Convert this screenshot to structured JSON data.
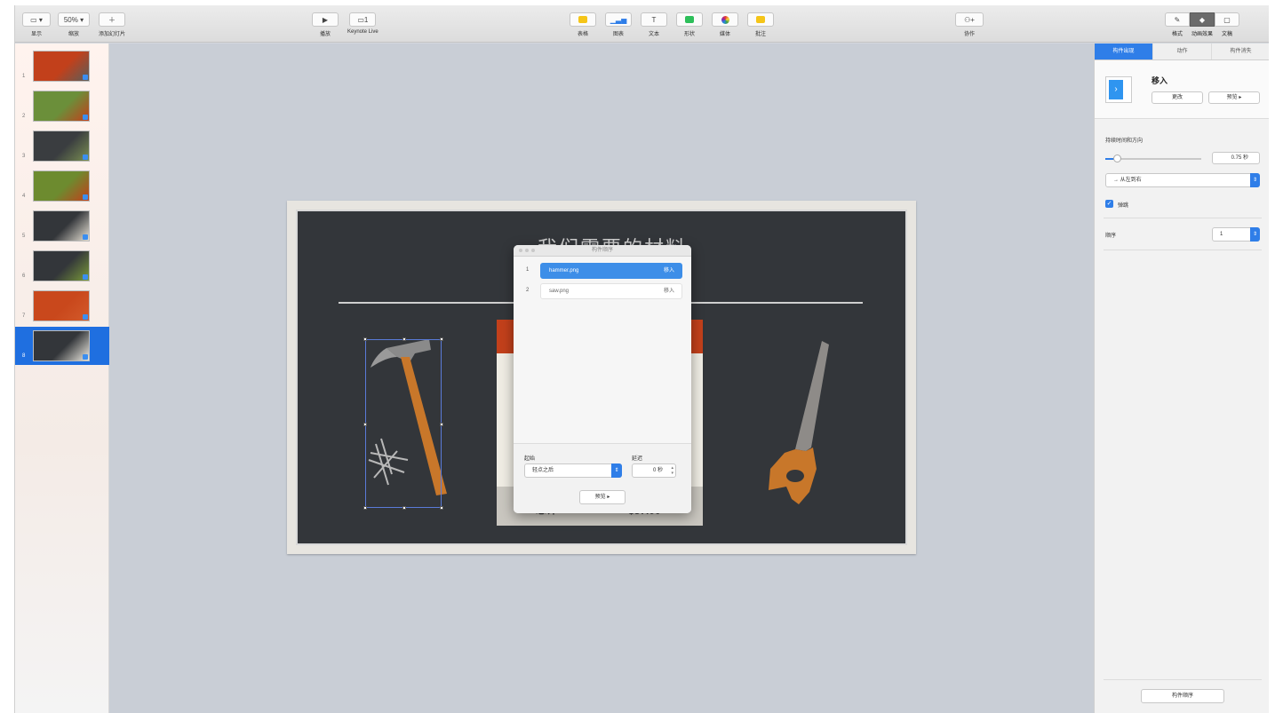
{
  "toolbar": {
    "view_label": "显示",
    "zoom_value": "50%",
    "zoom_label": "缩放",
    "add_slide_label": "添加幻灯片",
    "play_label": "播放",
    "keynote_live_label": "Keynote Live",
    "table_label": "表格",
    "chart_label": "图表",
    "text_label": "文本",
    "shape_label": "形状",
    "media_label": "媒体",
    "comment_label": "批注",
    "collaborate_label": "协作",
    "format_label": "格式",
    "animate_label": "动画效果",
    "document_label": "文稿"
  },
  "navigator": {
    "slides": [
      {
        "number": "1",
        "colors": [
          "#c2401b",
          "#5b5e5a"
        ]
      },
      {
        "number": "2",
        "colors": [
          "#6b8f3a",
          "#c2401b"
        ]
      },
      {
        "number": "3",
        "colors": [
          "#3a3d40",
          "#7a8f52"
        ]
      },
      {
        "number": "4",
        "colors": [
          "#6d8b2f",
          "#c2401b"
        ]
      },
      {
        "number": "5",
        "colors": [
          "#33363a",
          "#e8e2d6"
        ]
      },
      {
        "number": "6",
        "colors": [
          "#33363a",
          "#7a9a3a"
        ]
      },
      {
        "number": "7",
        "colors": [
          "#c9481c",
          "#d35a2a"
        ]
      },
      {
        "number": "8",
        "colors": [
          "#33363a",
          "#efece3"
        ]
      }
    ],
    "selected_index": 7
  },
  "slide": {
    "title": "我们需要的材料",
    "total_label": "总计",
    "total_value": "$37.00"
  },
  "build_popup": {
    "title": "构件顺序",
    "builds": [
      {
        "number": "1",
        "file": "hammer.png",
        "effect": "移入",
        "selected": true
      },
      {
        "number": "2",
        "file": "saw.png",
        "effect": "移入",
        "selected": false
      }
    ],
    "start_label": "起始",
    "start_value": "轻点之后",
    "delay_label": "延迟",
    "delay_value": "0 秒",
    "preview_button": "预览 ▸"
  },
  "inspector": {
    "tabs": [
      "构件出现",
      "动作",
      "构件消失"
    ],
    "active_tab": 0,
    "effect_name": "移入",
    "change_button": "更改",
    "preview_button": "预览 ▸",
    "duration_label": "持续时间和方向",
    "duration_value": "0.75 秒",
    "duration_fraction": 0.12,
    "direction_value": "→ 从左到右",
    "checkbox_label": "弹跳",
    "order_label": "顺序",
    "order_value": "1",
    "build_order_button": "构件顺序"
  },
  "colors": {
    "accent": "#2f7ee8",
    "slide_background": "#33363a",
    "slide_red": "#c2401b"
  }
}
